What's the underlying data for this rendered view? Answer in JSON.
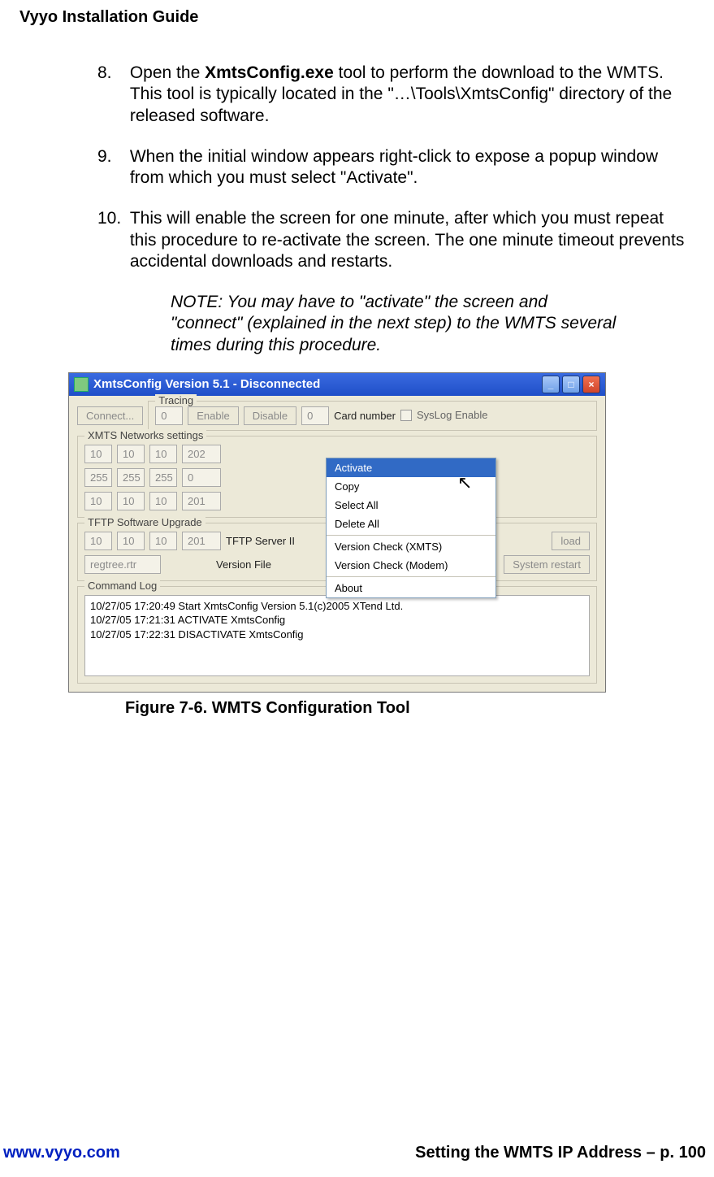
{
  "header": {
    "title": "Vyyo Installation Guide"
  },
  "steps": {
    "s8": {
      "num": "8.",
      "pre": "Open the ",
      "boldtool": "XmtsConfig.exe",
      "post": " tool  to perform the download to the WMTS. This tool is typically located in the \"…\\Tools\\XmtsConfig\" directory of the released software."
    },
    "s9": {
      "num": "9.",
      "text": "When the initial window appears right-click to expose a popup window from which you must select \"Activate\"."
    },
    "s10": {
      "num": "10.",
      "text": "This will enable the screen for one minute, after which you must repeat this procedure to re-activate the screen. The one minute timeout prevents accidental downloads and restarts."
    },
    "note": "NOTE:  You may have to \"activate\" the screen and \"connect\" (explained in the next step) to the WMTS several times during this procedure."
  },
  "dialog": {
    "title": "XmtsConfig Version 5.1  -  Disconnected",
    "connect": "Connect...",
    "tracing": {
      "legend": "Tracing",
      "val": "0",
      "enable": "Enable",
      "disable": "Disable",
      "card": "0",
      "cardlabel": "Card number",
      "syslog": "SysLog Enable"
    },
    "nets": {
      "legend": "XMTS Networks settings",
      "row1": [
        "10",
        "10",
        "10",
        "202"
      ],
      "row2": [
        "255",
        "255",
        "255",
        "0"
      ],
      "row3": [
        "10",
        "10",
        "10",
        "201"
      ]
    },
    "tftp": {
      "legend": "TFTP Software Upgrade",
      "ip": [
        "10",
        "10",
        "10",
        "201"
      ],
      "serverlabel": "TFTP Server II",
      "loadbtn": "load",
      "loadbtn2": "oad",
      "file": "regtree.rtr",
      "verlabel": "Version File",
      "sysrestart": "System restart"
    },
    "cmdlog": {
      "legend": "Command Log",
      "lines": "10/27/05 17:20:49 Start XmtsConfig Version 5.1(c)2005 XTend Ltd.\n10/27/05 17:21:31 ACTIVATE XmtsConfig\n10/27/05 17:22:31 DISACTIVATE XmtsConfig"
    },
    "menu": {
      "activate": "Activate",
      "copy": "Copy",
      "selectall": "Select All",
      "deleteall": "Delete All",
      "vcx": "Version Check (XMTS)",
      "vcm": "Version Check (Modem)",
      "about": "About"
    }
  },
  "figure": {
    "caption": "Figure 7-6. WMTS Configuration Tool"
  },
  "footer": {
    "url": "www.vyyo.com",
    "section": "Setting the WMTS IP Address – p. 100"
  }
}
